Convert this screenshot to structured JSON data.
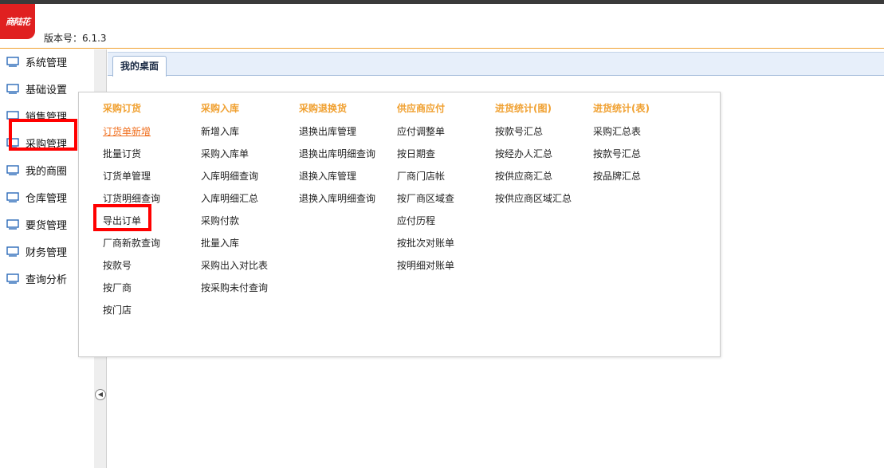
{
  "header": {
    "logo_text": "商陆花",
    "version": "版本号：6.1.3"
  },
  "sidebar": {
    "items": [
      {
        "label": "系统管理"
      },
      {
        "label": "基础设置"
      },
      {
        "label": "销售管理"
      },
      {
        "label": "采购管理"
      },
      {
        "label": "我的商圈"
      },
      {
        "label": "仓库管理"
      },
      {
        "label": "要货管理"
      },
      {
        "label": "财务管理"
      },
      {
        "label": "查询分析"
      }
    ]
  },
  "tabs": [
    {
      "label": "我的桌面"
    }
  ],
  "menu": {
    "columns": [
      {
        "title": "采购订货",
        "items": [
          "订货单新增",
          "批量订货",
          "订货单管理",
          "订货明细查询",
          "导出订单",
          "厂商新款查询",
          "按款号",
          "按厂商",
          "按门店"
        ]
      },
      {
        "title": "采购入库",
        "items": [
          "新增入库",
          "采购入库单",
          "入库明细查询",
          "入库明细汇总",
          "采购付款",
          "批量入库",
          "采购出入对比表",
          "按采购未付查询"
        ]
      },
      {
        "title": "采购退换货",
        "items": [
          "退换出库管理",
          "退换出库明细查询",
          "退换入库管理",
          "退换入库明细查询"
        ]
      },
      {
        "title": "供应商应付",
        "items": [
          "应付调整单",
          "按日期查",
          "厂商门店帐",
          "按厂商区域查",
          "应付历程",
          "按批次对账单",
          "按明细对账单"
        ]
      },
      {
        "title": "进货统计(图)",
        "items": [
          "按款号汇总",
          "按经办人汇总",
          "按供应商汇总",
          "按供应商区域汇总"
        ]
      },
      {
        "title": "进货统计(表)",
        "items": [
          "采购汇总表",
          "按款号汇总",
          "按品牌汇总"
        ]
      }
    ]
  },
  "colors": {
    "accent": "#f0a030",
    "highlight": "#ff0000",
    "icon": "#2a6ab8"
  }
}
